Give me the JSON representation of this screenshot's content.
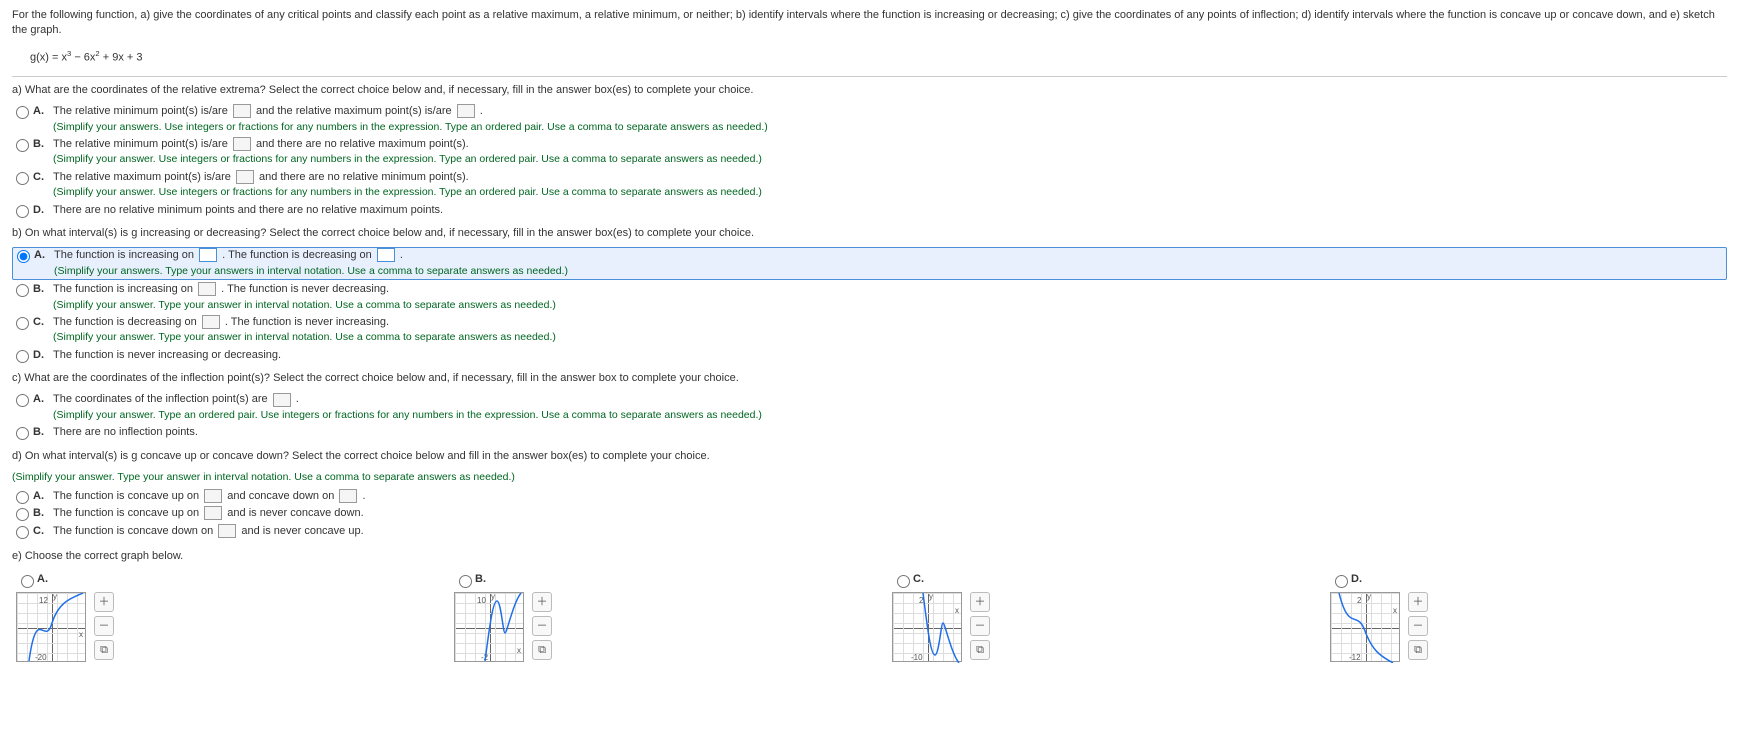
{
  "problem": {
    "intro": "For the following function, a) give the coordinates of any critical points and classify each point as a relative maximum, a relative minimum, or neither; b) identify intervals where the function is increasing or decreasing; c) give the coordinates of any points of inflection; d) identify intervals where the function is concave up or concave down, and e) sketch the graph.",
    "formula": "g(x) = x³ − 6x² + 9x + 3"
  },
  "partA": {
    "prompt": "a) What are the coordinates of the relative extrema? Select the correct choice below and, if necessary, fill in the answer box(es) to complete your choice.",
    "optA": {
      "letter": "A.",
      "t1": "The relative minimum point(s) is/are",
      "t2": "and the relative maximum point(s) is/are",
      "t3": ".",
      "hint": "(Simplify your answers. Use integers or fractions for any numbers in the expression. Type an ordered pair. Use a comma to separate answers as needed.)"
    },
    "optB": {
      "letter": "B.",
      "t1": "The relative minimum point(s) is/are",
      "t2": "and there are no relative maximum point(s).",
      "hint": "(Simplify your answer. Use integers or fractions for any numbers in the expression. Type an ordered pair. Use a comma to separate answers as needed.)"
    },
    "optC": {
      "letter": "C.",
      "t1": "The relative maximum point(s) is/are",
      "t2": "and there are no relative minimum point(s).",
      "hint": "(Simplify your answer. Use integers or fractions for any numbers in the expression. Type an ordered pair. Use a comma to separate answers as needed.)"
    },
    "optD": {
      "letter": "D.",
      "text": "There are no relative minimum points and there are no relative maximum points."
    }
  },
  "partB": {
    "prompt": "b) On what interval(s) is g increasing or decreasing? Select the correct choice below and, if necessary, fill in the answer box(es) to complete your choice.",
    "optA": {
      "letter": "A.",
      "t1": "The function is increasing on",
      "t2": ". The function is decreasing on",
      "t3": ".",
      "hint": "(Simplify your answers. Type your answers in interval notation. Use a comma to separate answers as needed.)"
    },
    "optB": {
      "letter": "B.",
      "t1": "The function is increasing on",
      "t2": ". The function is never decreasing.",
      "hint": "(Simplify your answer. Type your answer in interval notation. Use a comma to separate answers as needed.)"
    },
    "optC": {
      "letter": "C.",
      "t1": "The function is decreasing on",
      "t2": ". The function is never increasing.",
      "hint": "(Simplify your answer. Type your answer in interval notation. Use a comma to separate answers as needed.)"
    },
    "optD": {
      "letter": "D.",
      "text": "The function is never increasing or decreasing."
    }
  },
  "partC": {
    "prompt": "c) What are the coordinates of the inflection point(s)? Select the correct choice below and, if necessary, fill in the answer box to complete your choice.",
    "optA": {
      "letter": "A.",
      "t1": "The coordinates of the inflection point(s) are",
      "t2": ".",
      "hint": "(Simplify your answer. Type an ordered pair. Use integers or fractions for any numbers in the expression. Use a comma to separate answers as needed.)"
    },
    "optB": {
      "letter": "B.",
      "text": "There are no inflection points."
    }
  },
  "partD": {
    "prompt": "d) On what interval(s) is g concave up or concave down? Select the correct choice below and fill in the answer box(es) to complete your choice.",
    "hint": "(Simplify your answer. Type your answer in interval notation. Use a comma to separate answers as needed.)",
    "optA": {
      "letter": "A.",
      "t1": "The function is concave up on",
      "t2": "and concave down on",
      "t3": "."
    },
    "optB": {
      "letter": "B.",
      "t1": "The function is concave up on",
      "t2": "and is never concave down."
    },
    "optC": {
      "letter": "C.",
      "t1": "The function is concave down on",
      "t2": "and is never concave up."
    }
  },
  "partE": {
    "prompt": "e) Choose the correct graph below.",
    "labels": {
      "A": "A.",
      "B": "B.",
      "C": "C.",
      "D": "D."
    },
    "axes": {
      "A": {
        "ytop": "12",
        "ybot": "-20",
        "xr": "8"
      },
      "B": {
        "ytop": "10",
        "ybot": "-2",
        "xl": "-8",
        "xr": "8"
      },
      "C": {
        "ytop": "2",
        "ybot": "-10",
        "xl": "-8",
        "xr": "8"
      },
      "D": {
        "ytop": "2",
        "ybot": "-12",
        "xr": "8"
      }
    }
  },
  "icons": {
    "zoomIn": "�🔍+",
    "zoomOut": "🔍−",
    "popout": "⧉"
  }
}
